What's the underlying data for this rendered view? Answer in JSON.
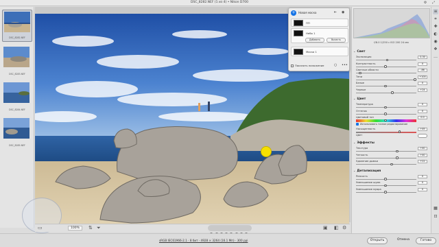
{
  "window": {
    "title": "DSC_8282.NEF (1 из 4) • Nikon D700"
  },
  "filmstrip": {
    "items": [
      {
        "label": "DSC_8282.NEF",
        "selected": true
      },
      {
        "label": "DSC_8283.NEF",
        "selected": false
      },
      {
        "label": "DSC_8284.NEF",
        "selected": false
      },
      {
        "label": "DSC_8285.NEF",
        "selected": false
      }
    ]
  },
  "mask_panel": {
    "header": "Новая маска",
    "mask1_label": "ПП",
    "mask2_label": "Небо 1",
    "add_button": "Добавить",
    "subtract_button": "Вычесть",
    "mask3_label": "Маска 1",
    "overlay_label": "Показать наложение"
  },
  "histogram": {
    "info": "f/8.0  1/250 с  ISO 200  24 мм"
  },
  "adjustments": {
    "light": {
      "title": "Свет",
      "rows": [
        {
          "name": "Экспозиция",
          "value": "0.30",
          "level": 0.53
        },
        {
          "name": "Контрастность",
          "value": "0",
          "level": 0.5
        },
        {
          "name": "Светлые области",
          "value": "-86",
          "level": 0.07
        },
        {
          "name": "Тени",
          "value": "+100",
          "level": 1.0
        },
        {
          "name": "Белые",
          "value": "0",
          "level": 0.5
        },
        {
          "name": "Черные",
          "value": "+24",
          "level": 0.62
        }
      ]
    },
    "color": {
      "title": "Цвет",
      "rows": [
        {
          "name": "Температура",
          "value": "0",
          "level": 0.5
        },
        {
          "name": "Оттенок",
          "value": "0",
          "level": 0.5
        }
      ],
      "hue_label": "Цветовой тон",
      "hue_value": "0.0",
      "fine_label": "Использовать точное редактирование",
      "sat_label": "Насыщенность",
      "sat_value": "+49",
      "sat_level": 0.74,
      "color_label": "Цвет"
    },
    "effects": {
      "title": "Эффекты",
      "rows": [
        {
          "name": "Текстура",
          "value": "+40",
          "level": 0.7
        },
        {
          "name": "Четкость",
          "value": "+40",
          "level": 0.7
        },
        {
          "name": "Удаление дымки",
          "value": "+22",
          "level": 0.61
        }
      ]
    },
    "detail": {
      "title": "Детализация",
      "rows": [
        {
          "name": "Резкость",
          "value": "0",
          "level": 0.5
        },
        {
          "name": "Уменьшение шума",
          "value": "0",
          "level": 0.5
        },
        {
          "name": "Уменьшение муара",
          "value": "0",
          "level": 0.5
        }
      ]
    }
  },
  "bottombar": {
    "zoom": "100%"
  },
  "statusbar": {
    "info": "sRGB IEC61966-2.1 · 8 бит · 4928 × 3264 (16.1 Мп) · 300 ppi",
    "open_button": "Открыть",
    "cancel_button": "Отмена",
    "done_button": "Готово"
  },
  "colors": {
    "accent": "#1473e6",
    "cursor": "#f6e000"
  }
}
